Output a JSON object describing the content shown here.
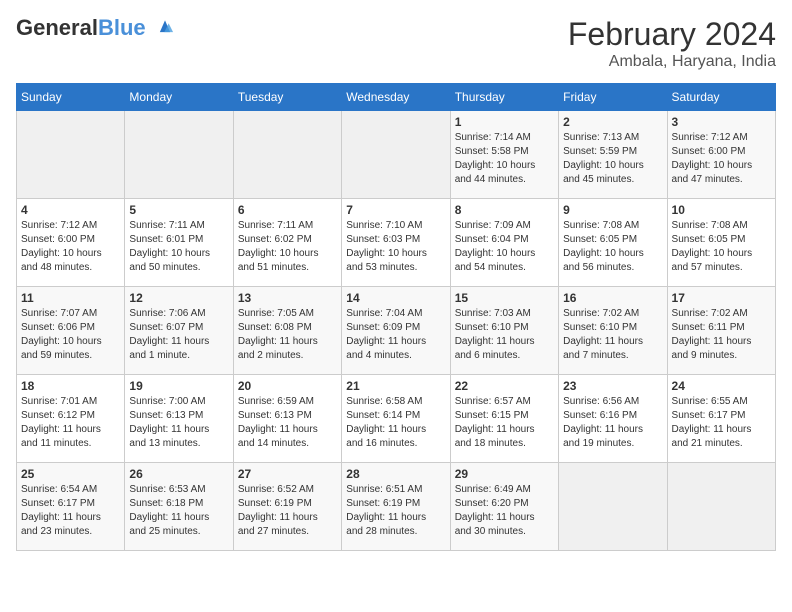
{
  "logo": {
    "line1": "General",
    "line2": "Blue"
  },
  "title": "February 2024",
  "subtitle": "Ambala, Haryana, India",
  "weekdays": [
    "Sunday",
    "Monday",
    "Tuesday",
    "Wednesday",
    "Thursday",
    "Friday",
    "Saturday"
  ],
  "weeks": [
    [
      {
        "day": "",
        "info": ""
      },
      {
        "day": "",
        "info": ""
      },
      {
        "day": "",
        "info": ""
      },
      {
        "day": "",
        "info": ""
      },
      {
        "day": "1",
        "info": "Sunrise: 7:14 AM\nSunset: 5:58 PM\nDaylight: 10 hours\nand 44 minutes."
      },
      {
        "day": "2",
        "info": "Sunrise: 7:13 AM\nSunset: 5:59 PM\nDaylight: 10 hours\nand 45 minutes."
      },
      {
        "day": "3",
        "info": "Sunrise: 7:12 AM\nSunset: 6:00 PM\nDaylight: 10 hours\nand 47 minutes."
      }
    ],
    [
      {
        "day": "4",
        "info": "Sunrise: 7:12 AM\nSunset: 6:00 PM\nDaylight: 10 hours\nand 48 minutes."
      },
      {
        "day": "5",
        "info": "Sunrise: 7:11 AM\nSunset: 6:01 PM\nDaylight: 10 hours\nand 50 minutes."
      },
      {
        "day": "6",
        "info": "Sunrise: 7:11 AM\nSunset: 6:02 PM\nDaylight: 10 hours\nand 51 minutes."
      },
      {
        "day": "7",
        "info": "Sunrise: 7:10 AM\nSunset: 6:03 PM\nDaylight: 10 hours\nand 53 minutes."
      },
      {
        "day": "8",
        "info": "Sunrise: 7:09 AM\nSunset: 6:04 PM\nDaylight: 10 hours\nand 54 minutes."
      },
      {
        "day": "9",
        "info": "Sunrise: 7:08 AM\nSunset: 6:05 PM\nDaylight: 10 hours\nand 56 minutes."
      },
      {
        "day": "10",
        "info": "Sunrise: 7:08 AM\nSunset: 6:05 PM\nDaylight: 10 hours\nand 57 minutes."
      }
    ],
    [
      {
        "day": "11",
        "info": "Sunrise: 7:07 AM\nSunset: 6:06 PM\nDaylight: 10 hours\nand 59 minutes."
      },
      {
        "day": "12",
        "info": "Sunrise: 7:06 AM\nSunset: 6:07 PM\nDaylight: 11 hours\nand 1 minute."
      },
      {
        "day": "13",
        "info": "Sunrise: 7:05 AM\nSunset: 6:08 PM\nDaylight: 11 hours\nand 2 minutes."
      },
      {
        "day": "14",
        "info": "Sunrise: 7:04 AM\nSunset: 6:09 PM\nDaylight: 11 hours\nand 4 minutes."
      },
      {
        "day": "15",
        "info": "Sunrise: 7:03 AM\nSunset: 6:10 PM\nDaylight: 11 hours\nand 6 minutes."
      },
      {
        "day": "16",
        "info": "Sunrise: 7:02 AM\nSunset: 6:10 PM\nDaylight: 11 hours\nand 7 minutes."
      },
      {
        "day": "17",
        "info": "Sunrise: 7:02 AM\nSunset: 6:11 PM\nDaylight: 11 hours\nand 9 minutes."
      }
    ],
    [
      {
        "day": "18",
        "info": "Sunrise: 7:01 AM\nSunset: 6:12 PM\nDaylight: 11 hours\nand 11 minutes."
      },
      {
        "day": "19",
        "info": "Sunrise: 7:00 AM\nSunset: 6:13 PM\nDaylight: 11 hours\nand 13 minutes."
      },
      {
        "day": "20",
        "info": "Sunrise: 6:59 AM\nSunset: 6:13 PM\nDaylight: 11 hours\nand 14 minutes."
      },
      {
        "day": "21",
        "info": "Sunrise: 6:58 AM\nSunset: 6:14 PM\nDaylight: 11 hours\nand 16 minutes."
      },
      {
        "day": "22",
        "info": "Sunrise: 6:57 AM\nSunset: 6:15 PM\nDaylight: 11 hours\nand 18 minutes."
      },
      {
        "day": "23",
        "info": "Sunrise: 6:56 AM\nSunset: 6:16 PM\nDaylight: 11 hours\nand 19 minutes."
      },
      {
        "day": "24",
        "info": "Sunrise: 6:55 AM\nSunset: 6:17 PM\nDaylight: 11 hours\nand 21 minutes."
      }
    ],
    [
      {
        "day": "25",
        "info": "Sunrise: 6:54 AM\nSunset: 6:17 PM\nDaylight: 11 hours\nand 23 minutes."
      },
      {
        "day": "26",
        "info": "Sunrise: 6:53 AM\nSunset: 6:18 PM\nDaylight: 11 hours\nand 25 minutes."
      },
      {
        "day": "27",
        "info": "Sunrise: 6:52 AM\nSunset: 6:19 PM\nDaylight: 11 hours\nand 27 minutes."
      },
      {
        "day": "28",
        "info": "Sunrise: 6:51 AM\nSunset: 6:19 PM\nDaylight: 11 hours\nand 28 minutes."
      },
      {
        "day": "29",
        "info": "Sunrise: 6:49 AM\nSunset: 6:20 PM\nDaylight: 11 hours\nand 30 minutes."
      },
      {
        "day": "",
        "info": ""
      },
      {
        "day": "",
        "info": ""
      }
    ]
  ]
}
